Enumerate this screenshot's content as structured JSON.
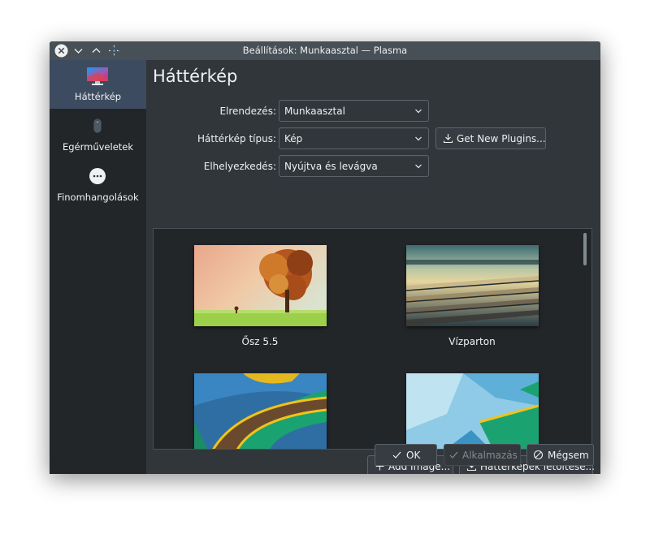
{
  "window": {
    "title": "Beállítások: Munkaasztal — Plasma",
    "titlebar_color": "#475057",
    "bg_color": "#31363b"
  },
  "sidebar": {
    "items": [
      {
        "label": "Háttérkép",
        "icon": "wallpaper-monitor-icon",
        "active": true
      },
      {
        "label": "Egérműveletek",
        "icon": "mouse-icon",
        "active": false
      },
      {
        "label": "Finomhangolások",
        "icon": "more-options-icon",
        "active": false
      }
    ]
  },
  "main": {
    "title": "Háttérkép",
    "layout_label": "Elrendezés:",
    "layout_value": "Munkaasztal",
    "type_label": "Háttérkép típus:",
    "type_value": "Kép",
    "get_plugins_label": "Get New Plugins...",
    "positioning_label": "Elhelyezkedés:",
    "positioning_value": "Nyújtva és levágva"
  },
  "gallery": {
    "items": [
      {
        "label": "Ősz 5.5",
        "selected": true
      },
      {
        "label": "Vízparton",
        "selected": false
      },
      {
        "label": "",
        "selected": false
      },
      {
        "label": "",
        "selected": false
      }
    ]
  },
  "actions": {
    "add_image_label": "Add Image...",
    "download_label": "Háttérképek letöltése...",
    "ok_label": "OK",
    "apply_label": "Alkalmazás",
    "cancel_label": "Mégsem"
  },
  "colors": {
    "accent": "#3daee9",
    "sidebar_active": "#3c4b5f",
    "sidebar_bg": "#232629"
  }
}
